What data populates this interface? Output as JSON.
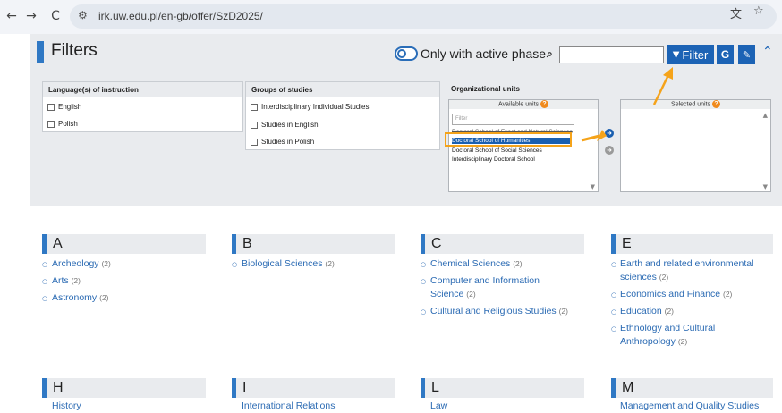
{
  "browser": {
    "url": "irk.uw.edu.pl/en-gb/offer/SzD2025/"
  },
  "filters": {
    "title": "Filters",
    "toggle_label": "Only with active phase",
    "search_value": "",
    "filter_button": "Filter",
    "g_button": "G"
  },
  "languages": {
    "header": "Language(s) of instruction",
    "items": [
      "English",
      "Polish"
    ]
  },
  "groups": {
    "header": "Groups of studies",
    "items": [
      "Interdisciplinary Individual Studies",
      "Studies in English",
      "Studies in Polish"
    ]
  },
  "org_units": {
    "header": "Organizational units",
    "available_label": "Available units",
    "selected_label": "Selected units",
    "filter_placeholder": "Filter",
    "available": [
      "Doctoral School of Exact and Natural Sciences",
      "Doctoral School of Humanities",
      "Doctoral School of Social Sciences",
      "Interdisciplinary Doctoral School"
    ],
    "selected_item": "Doctoral School of Humanities"
  },
  "columns": [
    {
      "letter": "A",
      "items": [
        {
          "name": "Archeology",
          "count": "(2)"
        },
        {
          "name": "Arts",
          "count": "(2)"
        },
        {
          "name": "Astronomy",
          "count": "(2)"
        }
      ]
    },
    {
      "letter": "B",
      "items": [
        {
          "name": "Biological Sciences",
          "count": "(2)"
        }
      ]
    },
    {
      "letter": "C",
      "items": [
        {
          "name": "Chemical Sciences",
          "count": "(2)"
        },
        {
          "name": "Computer and Information",
          "name2": "Science",
          "count": "(2)"
        },
        {
          "name": "Cultural and Religious Studies",
          "count": "(2)"
        }
      ]
    },
    {
      "letter": "E",
      "items": [
        {
          "name": "Earth and related environmental",
          "name2": "sciences",
          "count": "(2)"
        },
        {
          "name": "Economics and Finance",
          "count": "(2)"
        },
        {
          "name": "Education",
          "count": "(2)"
        },
        {
          "name": "Ethnology and Cultural",
          "name2": "Anthropology",
          "count": "(2)"
        }
      ]
    }
  ],
  "row2_letters": [
    "H",
    "I",
    "L",
    "M"
  ],
  "row2_partial": [
    "History",
    "International Relations",
    "Law",
    "Management and Quality Studies"
  ],
  "colors": {
    "accent": "#2f78c4",
    "button": "#1c63b5",
    "highlight": "#f5a31a"
  }
}
